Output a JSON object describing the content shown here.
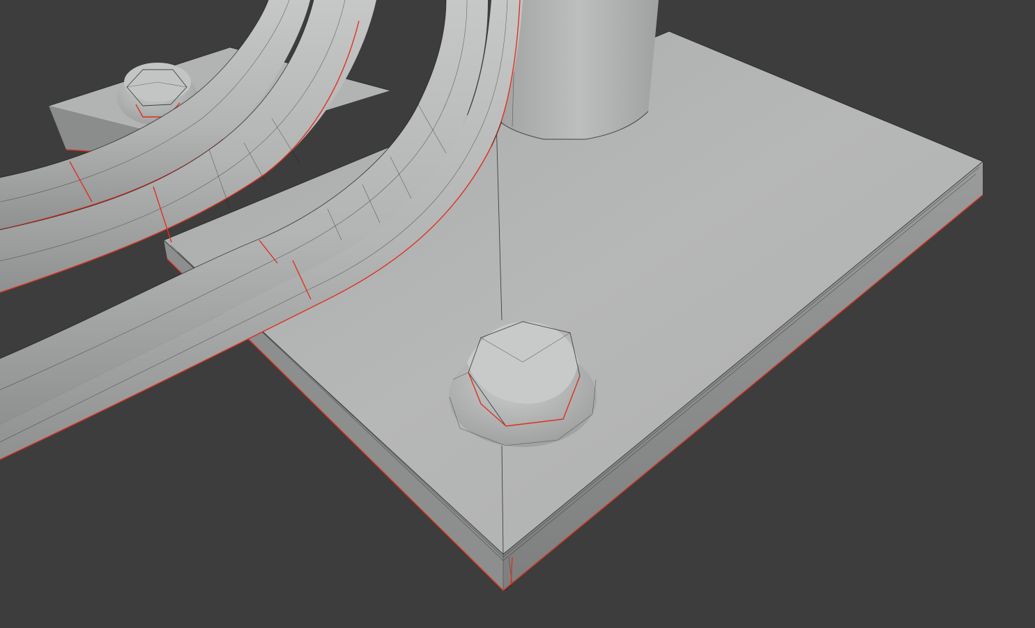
{
  "viewport": {
    "background_color": "#3d3d3d",
    "mesh_color": "#b8b8b8",
    "wire_color": "#1a1a1a",
    "seam_color": "#e0301e",
    "display_mode": "solid-with-wireframe"
  },
  "scene": {
    "objects": [
      {
        "name": "base-plate"
      },
      {
        "name": "bolt-front"
      },
      {
        "name": "bolt-back"
      },
      {
        "name": "pipe-1"
      },
      {
        "name": "pipe-2"
      },
      {
        "name": "pipe-3"
      },
      {
        "name": "pipe-4"
      },
      {
        "name": "post"
      }
    ]
  }
}
